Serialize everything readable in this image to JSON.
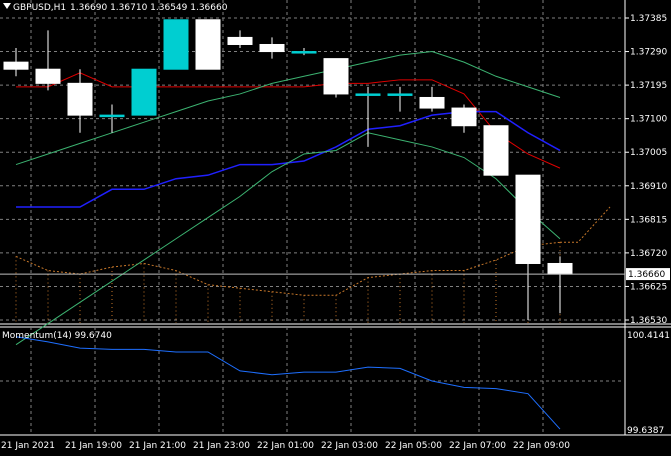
{
  "header": {
    "symbol_timeframe": "GBPUSD,H1",
    "ohlc": "1.36690 1.36710 1.36549 1.36660"
  },
  "indicator": {
    "label": "Momentum(14) 99.6740",
    "ylim": [
      99.6387,
      100.4141
    ],
    "tick_labels": [
      "100.4141",
      "99.6387"
    ]
  },
  "colors": {
    "background": "#000000",
    "grid": "#808080",
    "bull_candle": "#00ced1",
    "bear_candle": "#ffffff",
    "ma_fast": "#e00000",
    "ma_mid": "#2020ff",
    "ma_slow": "#3cb371",
    "envelope": "#c8782a",
    "momentum": "#1e6fff",
    "price_line": "#c0c0c0"
  },
  "chart_data": [
    {
      "type": "candlestick",
      "title": "GBPUSD,H1",
      "x": [
        "21 Jan 2021",
        "21 Jan 19:00",
        "21 Jan 21:00",
        "21 Jan 23:00",
        "22 Jan 01:00",
        "22 Jan 03:00",
        "22 Jan 05:00",
        "22 Jan 07:00",
        "22 Jan 09:00"
      ],
      "ylim": [
        1.3653,
        1.37385
      ],
      "y_ticks": [
        "1.37385",
        "1.37290",
        "1.37195",
        "1.37100",
        "1.37005",
        "1.36910",
        "1.36815",
        "1.36720",
        "1.36625",
        "1.36530"
      ],
      "current_price": "1.36660",
      "candles": [
        {
          "o": 1.3726,
          "h": 1.373,
          "l": 1.3722,
          "c": 1.3724
        },
        {
          "o": 1.3724,
          "h": 1.3735,
          "l": 1.3718,
          "c": 1.372
        },
        {
          "o": 1.372,
          "h": 1.3724,
          "l": 1.3706,
          "c": 1.3711
        },
        {
          "o": 1.3711,
          "h": 1.3714,
          "l": 1.3706,
          "c": 1.3711
        },
        {
          "o": 1.3711,
          "h": 1.3724,
          "l": 1.3711,
          "c": 1.3724
        },
        {
          "o": 1.3724,
          "h": 1.3738,
          "l": 1.3724,
          "c": 1.3738
        },
        {
          "o": 1.3738,
          "h": 1.3738,
          "l": 1.3724,
          "c": 1.3724
        },
        {
          "o": 1.3733,
          "h": 1.3735,
          "l": 1.373,
          "c": 1.3731
        },
        {
          "o": 1.3731,
          "h": 1.3733,
          "l": 1.3727,
          "c": 1.3729
        },
        {
          "o": 1.3729,
          "h": 1.373,
          "l": 1.3728,
          "c": 1.3729
        },
        {
          "o": 1.3727,
          "h": 1.3727,
          "l": 1.3716,
          "c": 1.3717
        },
        {
          "o": 1.3717,
          "h": 1.3719,
          "l": 1.3702,
          "c": 1.3717
        },
        {
          "o": 1.3717,
          "h": 1.3719,
          "l": 1.3712,
          "c": 1.3717
        },
        {
          "o": 1.3716,
          "h": 1.3719,
          "l": 1.3712,
          "c": 1.3713
        },
        {
          "o": 1.3713,
          "h": 1.3714,
          "l": 1.3706,
          "c": 1.3708
        },
        {
          "o": 1.3708,
          "h": 1.3708,
          "l": 1.3694,
          "c": 1.3694
        },
        {
          "o": 1.3694,
          "h": 1.3694,
          "l": 1.3653,
          "c": 1.3669
        },
        {
          "o": 1.3669,
          "h": 1.3671,
          "l": 1.36549,
          "c": 1.3666
        }
      ],
      "series": [
        {
          "values": [
            1.3719,
            1.3719,
            1.3723,
            1.3719,
            1.3719,
            1.3719,
            1.3719,
            1.3719,
            1.3719,
            1.3719,
            1.372,
            1.372,
            1.3721,
            1.3721,
            1.3717,
            1.3706,
            1.37,
            1.3696
          ]
        },
        {
          "values": [
            1.3685,
            1.3685,
            1.3685,
            1.369,
            1.369,
            1.3693,
            1.3694,
            1.3697,
            1.3697,
            1.3698,
            1.3702,
            1.3707,
            1.3708,
            1.3711,
            1.3712,
            1.3712,
            1.3706,
            1.3701
          ]
        },
        {
          "values": [
            1.3697,
            1.37,
            1.3703,
            1.3706,
            1.3709,
            1.3712,
            1.3715,
            1.3717,
            1.372,
            1.3722,
            1.3724,
            1.3726,
            1.3728,
            1.3729,
            1.3726,
            1.3722,
            1.3719,
            1.3716
          ]
        },
        {
          "values": [
            1.3646,
            1.3652,
            1.3658,
            1.3664,
            1.367,
            1.3676,
            1.3682,
            1.3688,
            1.3695,
            1.37,
            1.3701,
            1.3706,
            1.3704,
            1.3702,
            1.3699,
            1.3693,
            1.3684,
            1.3676
          ]
        },
        {
          "values": [
            1.3671,
            1.3667,
            1.3666,
            1.3668,
            1.3669,
            1.3667,
            1.3663,
            1.3662,
            1.3661,
            1.366,
            1.366,
            1.3665,
            1.3666,
            1.3667,
            1.3667,
            1.367,
            1.3674,
            1.3675
          ]
        }
      ]
    },
    {
      "type": "line",
      "title": "Momentum(14) 99.6740",
      "ylim": [
        99.6387,
        100.4141
      ],
      "series": [
        {
          "values": [
            100.4,
            100.36,
            100.31,
            100.3,
            100.3,
            100.28,
            100.28,
            100.13,
            100.1,
            100.12,
            100.12,
            100.16,
            100.15,
            100.05,
            100.0,
            99.99,
            99.95,
            99.67
          ]
        }
      ]
    }
  ]
}
